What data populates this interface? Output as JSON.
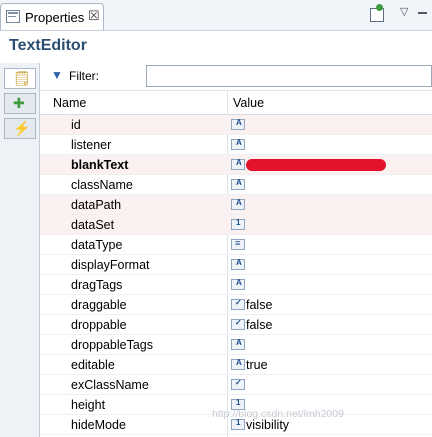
{
  "tab": {
    "label": "Properties",
    "close": "☒"
  },
  "header": {
    "title": "TextEditor"
  },
  "filter": {
    "label": "Filter:",
    "value": ""
  },
  "columns": {
    "name": "Name",
    "value": "Value"
  },
  "rows": [
    {
      "name": "id",
      "type": "A",
      "value": ""
    },
    {
      "name": "listener",
      "type": "A",
      "value": ""
    },
    {
      "name": "blankText",
      "type": "A",
      "value": "",
      "redacted": true
    },
    {
      "name": "className",
      "type": "A",
      "value": ""
    },
    {
      "name": "dataPath",
      "type": "A",
      "value": ""
    },
    {
      "name": "dataSet",
      "type": "num",
      "value": ""
    },
    {
      "name": "dataType",
      "type": "list",
      "value": ""
    },
    {
      "name": "displayFormat",
      "type": "A",
      "value": ""
    },
    {
      "name": "dragTags",
      "type": "A",
      "value": ""
    },
    {
      "name": "draggable",
      "type": "bool",
      "value": "false"
    },
    {
      "name": "droppable",
      "type": "bool",
      "value": "false"
    },
    {
      "name": "droppableTags",
      "type": "A",
      "value": ""
    },
    {
      "name": "editable",
      "type": "A",
      "value": "true"
    },
    {
      "name": "exClassName",
      "type": "bool",
      "value": ""
    },
    {
      "name": "height",
      "type": "num",
      "value": ""
    },
    {
      "name": "hideMode",
      "type": "num",
      "value": "visibility"
    }
  ],
  "watermark": "http://blog.csdn.net/lmh2009"
}
